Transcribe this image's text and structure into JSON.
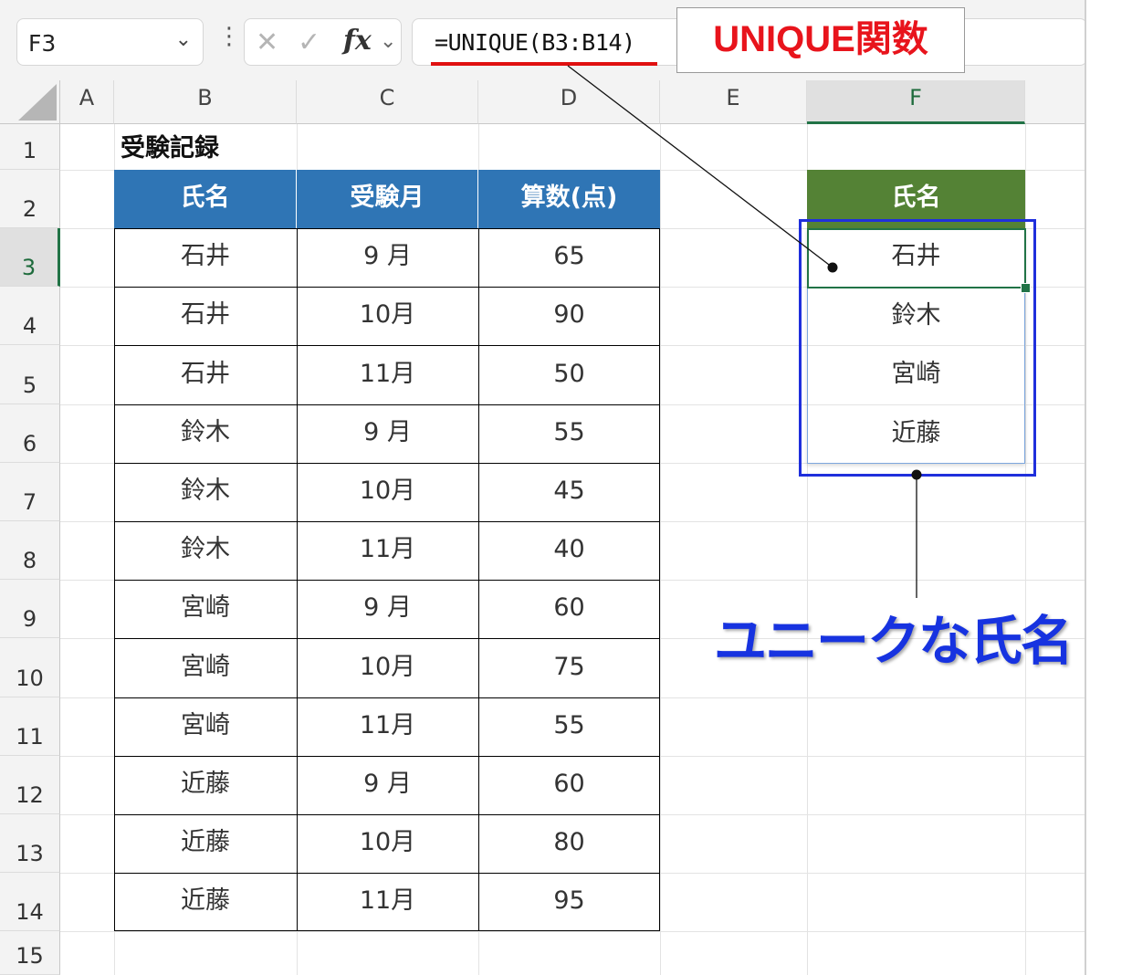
{
  "formula_bar": {
    "name_box": "F3",
    "chevron": "⌄",
    "kebab": "⋮",
    "cancel": "✕",
    "enter": "✓",
    "fx": "fx",
    "fx_chevron": "⌄",
    "formula": "=UNIQUE(B3:B14)"
  },
  "callout_title": "UNIQUE関数",
  "columns": [
    "A",
    "B",
    "C",
    "D",
    "E",
    "F"
  ],
  "rows": [
    "1",
    "2",
    "3",
    "4",
    "5",
    "6",
    "7",
    "8",
    "9",
    "10",
    "11",
    "12",
    "13",
    "14",
    "15"
  ],
  "sheet_title": "受験記録",
  "table": {
    "headers": [
      "氏名",
      "受験月",
      "算数(点)"
    ],
    "rows": [
      [
        "石井",
        "9 月",
        "65"
      ],
      [
        "石井",
        "10月",
        "90"
      ],
      [
        "石井",
        "11月",
        "50"
      ],
      [
        "鈴木",
        "9 月",
        "55"
      ],
      [
        "鈴木",
        "10月",
        "45"
      ],
      [
        "鈴木",
        "11月",
        "40"
      ],
      [
        "宮崎",
        "9 月",
        "60"
      ],
      [
        "宮崎",
        "10月",
        "75"
      ],
      [
        "宮崎",
        "11月",
        "55"
      ],
      [
        "近藤",
        "9 月",
        "60"
      ],
      [
        "近藤",
        "10月",
        "80"
      ],
      [
        "近藤",
        "11月",
        "95"
      ]
    ]
  },
  "result": {
    "header": "氏名",
    "values": [
      "石井",
      "鈴木",
      "宮崎",
      "近藤"
    ]
  },
  "annotation": "ユニークな氏名",
  "colors": {
    "table_header": "#2f75b5",
    "result_header": "#548235",
    "selection": "#217346",
    "callout_red": "#e8141c",
    "annotation_blue": "#1733e0"
  }
}
